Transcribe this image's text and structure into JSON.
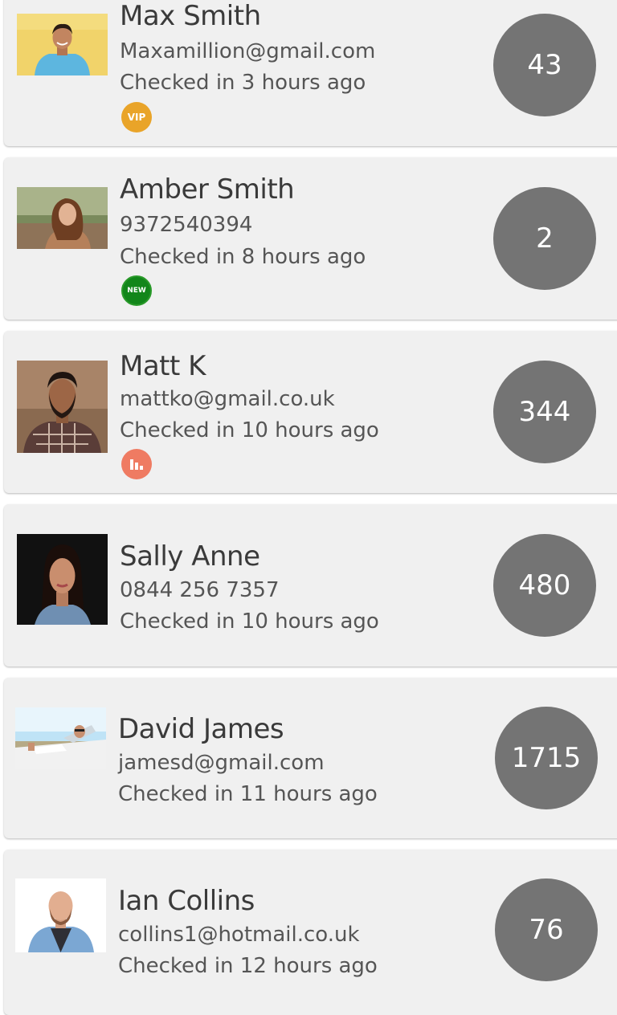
{
  "colors": {
    "card_bg": "#f0f0f0",
    "count_circle": "#747474",
    "vip_badge": "#e9a429",
    "new_badge": "#12861a",
    "stats_badge": "#ef7b62"
  },
  "customers": [
    {
      "name": "Max Smith",
      "contact": "Maxamillion@gmail.com",
      "checkin": "Checked in 3 hours ago",
      "badge": {
        "type": "vip",
        "label": "VIP",
        "icon": "vip-seal-icon"
      },
      "count": "43"
    },
    {
      "name": "Amber Smith",
      "contact": "9372540394",
      "checkin": "Checked in 8 hours ago",
      "badge": {
        "type": "new",
        "label": "NEW",
        "icon": "new-badge-icon"
      },
      "count": "2"
    },
    {
      "name": "Matt K",
      "contact": "mattko@gmail.co.uk",
      "checkin": "Checked in 10 hours ago",
      "badge": {
        "type": "stats",
        "label": "",
        "icon": "bar-chart-icon"
      },
      "count": "344"
    },
    {
      "name": "Sally Anne",
      "contact": "0844 256 7357",
      "checkin": "Checked in 10 hours ago",
      "count": "480"
    },
    {
      "name": "David James",
      "contact": "jamesd@gmail.com",
      "checkin": "Checked in 11 hours ago",
      "count": "1715"
    },
    {
      "name": "Ian Collins",
      "contact": "collins1@hotmail.co.uk",
      "checkin": "Checked in 12 hours ago",
      "count": "76"
    }
  ]
}
